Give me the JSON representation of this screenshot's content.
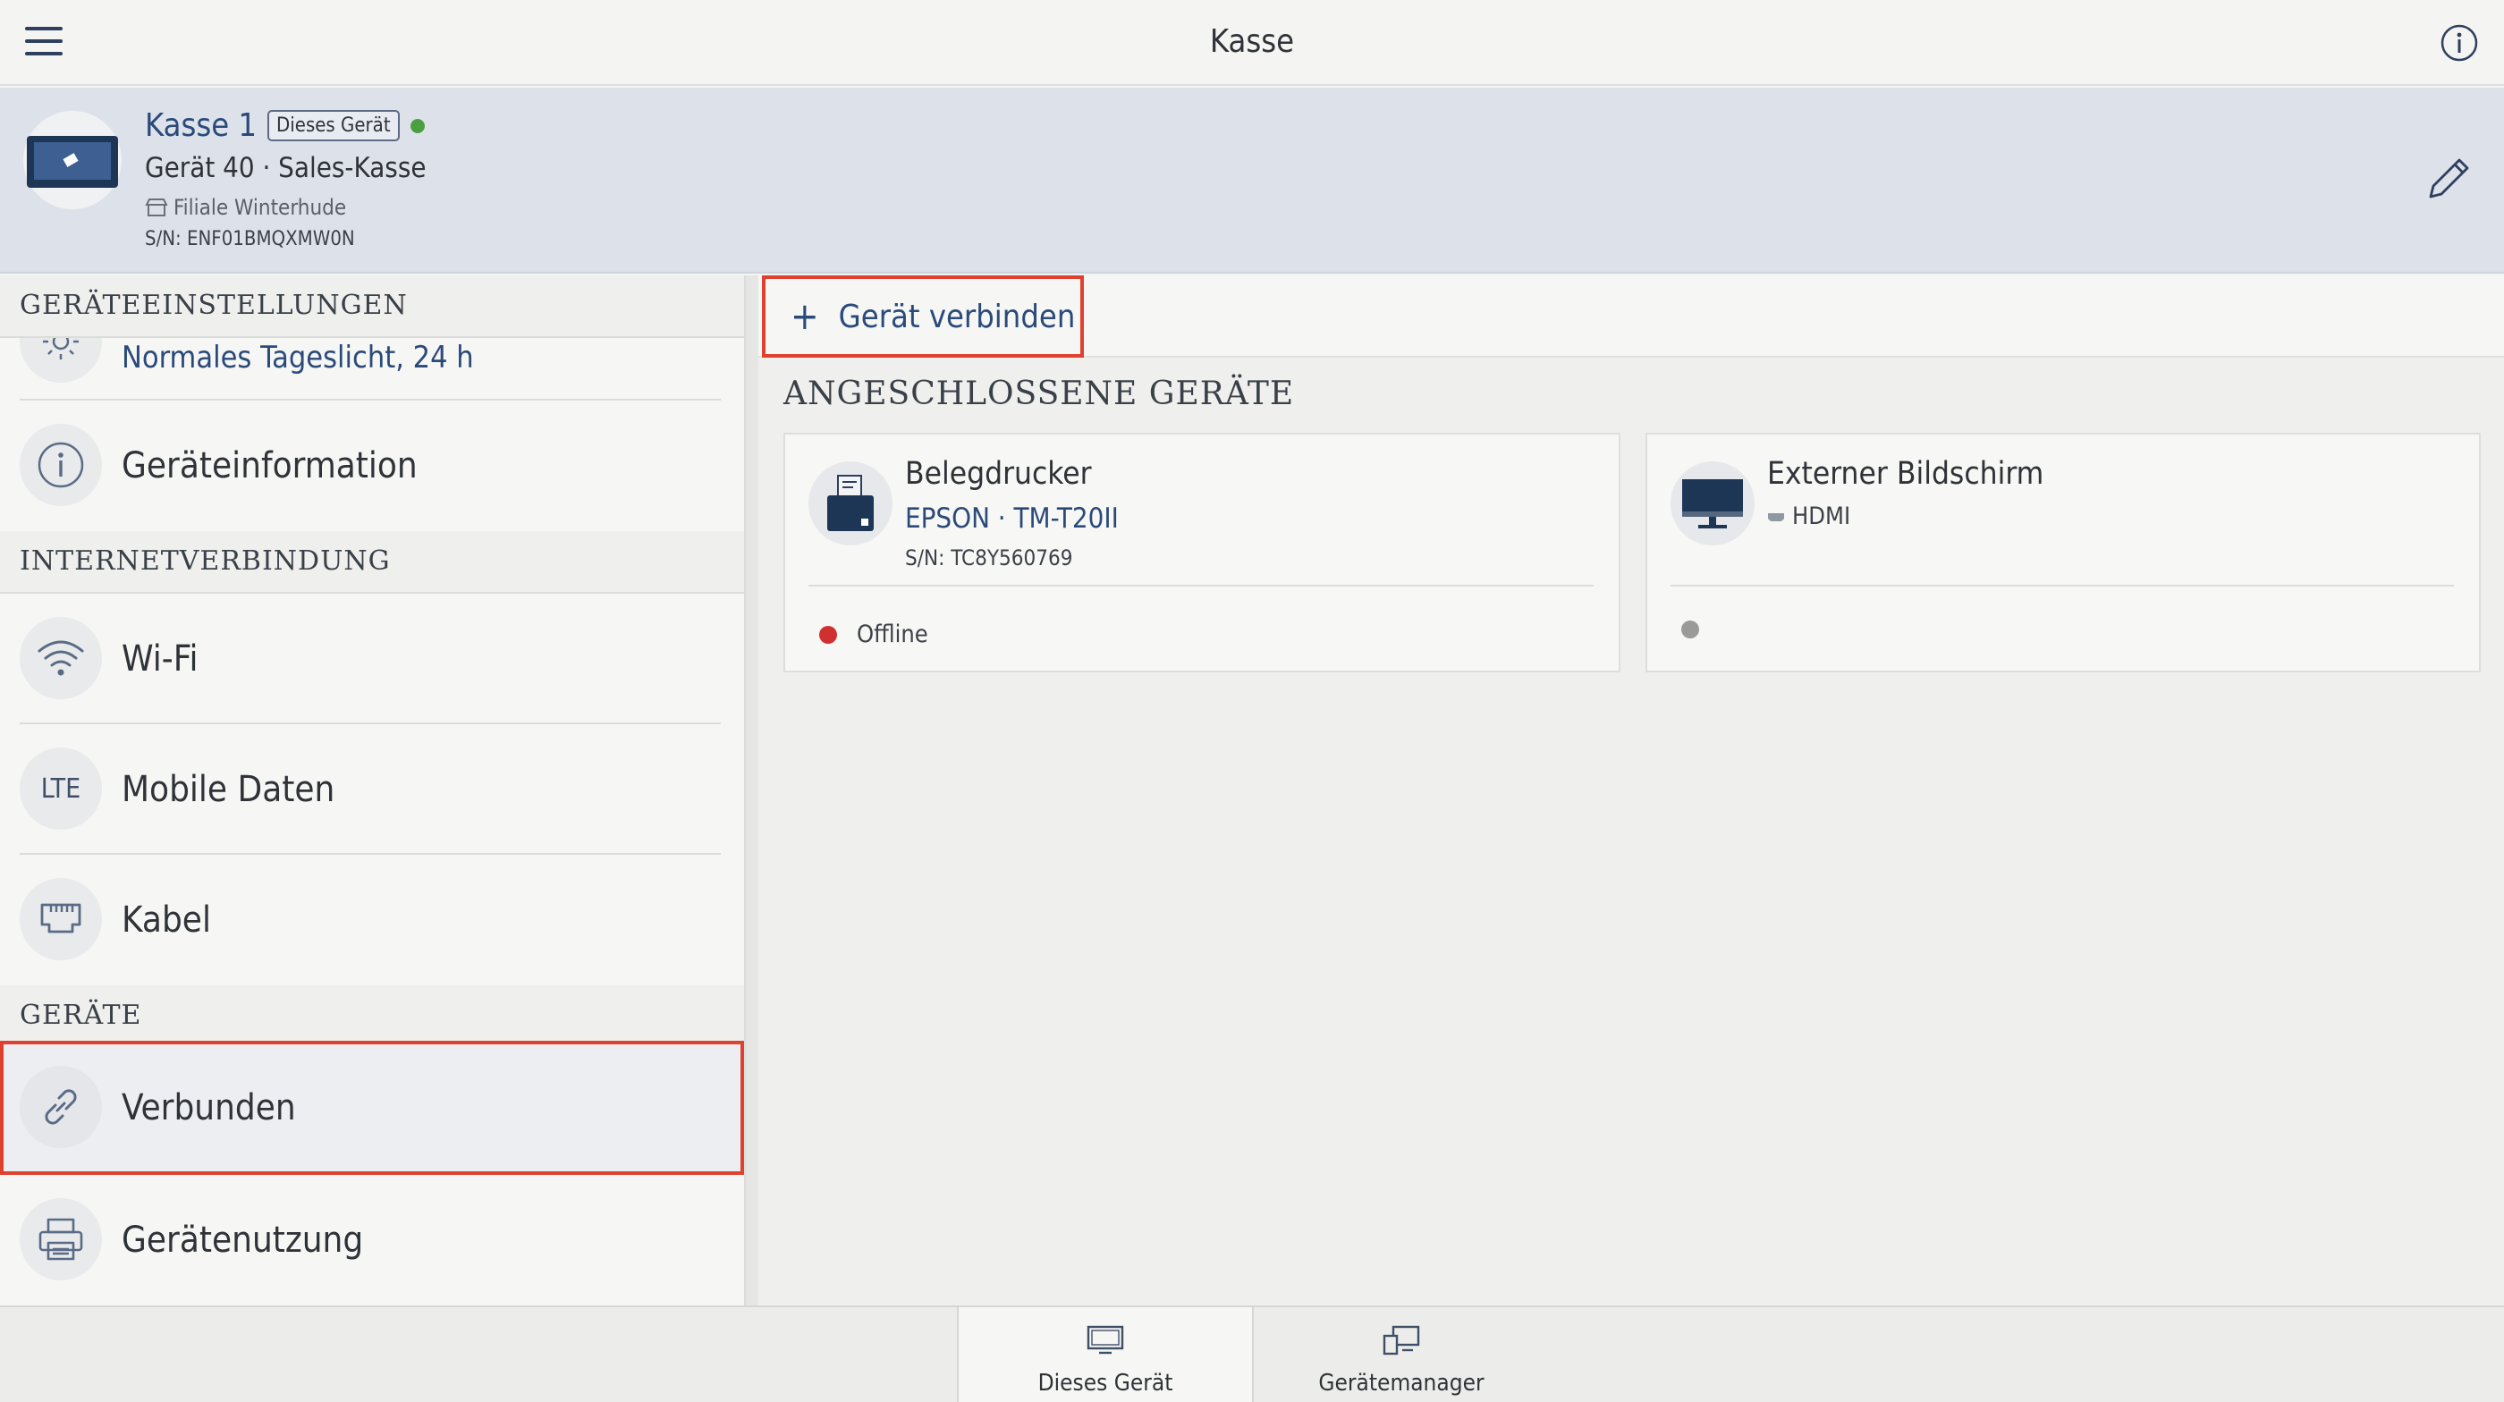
{
  "app": {
    "title": "Kasse"
  },
  "device": {
    "name": "Kasse 1",
    "badge": "Dieses Gerät",
    "model": "Gerät 40 · Sales-Kasse",
    "branch": "Filiale Winterhude",
    "serial": "S/N: ENF01BMQXMW0N",
    "online_color": "#4aa040"
  },
  "sidebar": {
    "sections": {
      "settings": "GERÄTEEINSTELLUNGEN",
      "internet": "INTERNETVERBINDUNG",
      "devices": "GERÄTE"
    },
    "items": {
      "daylight": {
        "label": "Normales Tageslicht, 24 h",
        "icon": "sun-icon"
      },
      "device_info": {
        "label": "Geräteinformation",
        "icon": "info-icon"
      },
      "wifi": {
        "label": "Wi-Fi",
        "icon": "wifi-icon"
      },
      "mobile": {
        "label": "Mobile Daten",
        "icon_text": "LTE"
      },
      "cable": {
        "label": "Kabel",
        "icon": "ethernet-icon"
      },
      "connected": {
        "label": "Verbunden",
        "icon": "link-icon",
        "selected": true
      },
      "usage": {
        "label": "Gerätenutzung",
        "icon": "printer-icon"
      }
    }
  },
  "main": {
    "connect_label": "Gerät verbinden",
    "section_title": "ANGESCHLOSSENE GERÄTE",
    "cards": {
      "printer": {
        "name": "Belegdrucker",
        "model": "EPSON · TM-T20II",
        "serial": "S/N: TC8Y560769",
        "status": "Offline",
        "status_color": "#d03030"
      },
      "display": {
        "name": "Externer Bildschirm",
        "connection": "HDMI",
        "status_color": "#9a9a9a"
      }
    }
  },
  "bottom_tabs": {
    "this_device": {
      "label": "Dieses Gerät",
      "active": true
    },
    "manager": {
      "label": "Gerätemanager",
      "active": false
    }
  },
  "colors": {
    "accent": "#2a4a7a",
    "highlight": "#e0402e"
  }
}
